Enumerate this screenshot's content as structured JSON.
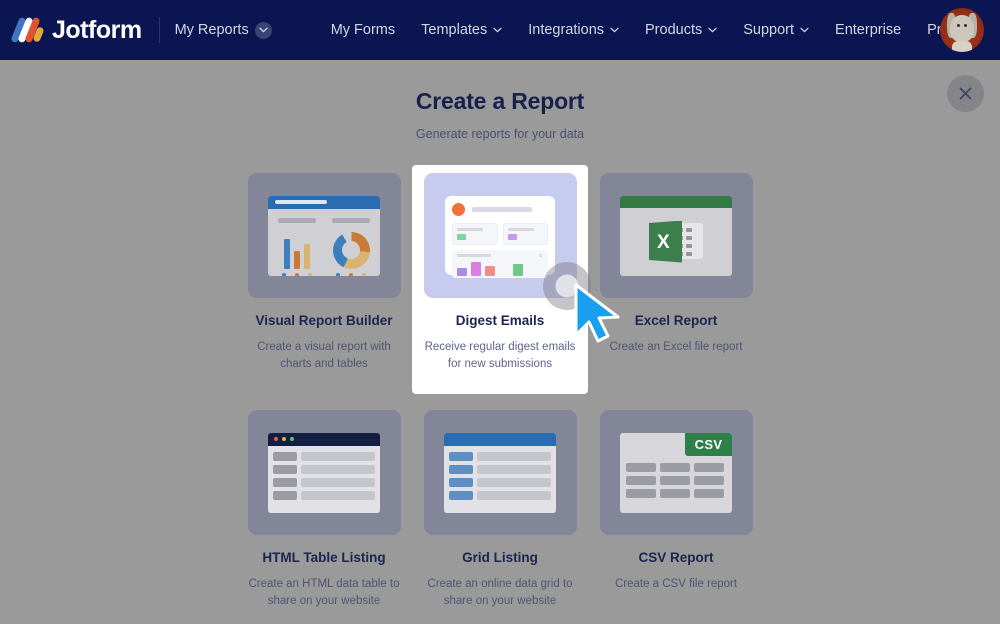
{
  "header": {
    "brand": "Jotform",
    "workspace": {
      "label": "My Reports",
      "chevron_icon": "chevron-down-icon"
    },
    "nav": [
      {
        "label": "My Forms",
        "has_chevron": false
      },
      {
        "label": "Templates",
        "has_chevron": true
      },
      {
        "label": "Integrations",
        "has_chevron": true
      },
      {
        "label": "Products",
        "has_chevron": true
      },
      {
        "label": "Support",
        "has_chevron": true
      },
      {
        "label": "Enterprise",
        "has_chevron": false
      },
      {
        "label": "Pricing",
        "has_chevron": false
      }
    ],
    "avatar_alt": "user-avatar",
    "bg_color": "#0a1551"
  },
  "modal": {
    "title": "Create a Report",
    "subtitle": "Generate reports for your data",
    "close_icon": "close-icon",
    "overlay_color": "#9a9a9a"
  },
  "cards": [
    {
      "id": "visual-report-builder",
      "title": "Visual Report Builder",
      "description": "Create a visual report with charts and tables",
      "selected": false,
      "icon": "visual-report-icon"
    },
    {
      "id": "digest-emails",
      "title": "Digest Emails",
      "description": "Receive regular digest emails for new submissions",
      "selected": true,
      "icon": "digest-email-icon"
    },
    {
      "id": "excel-report",
      "title": "Excel Report",
      "description": "Create an Excel file report",
      "selected": false,
      "icon": "excel-icon"
    },
    {
      "id": "html-table-listing",
      "title": "HTML Table Listing",
      "description": "Create an HTML data table to share on your website",
      "selected": false,
      "icon": "html-table-icon"
    },
    {
      "id": "grid-listing",
      "title": "Grid Listing",
      "description": "Create an online data grid to share on your website",
      "selected": false,
      "icon": "grid-listing-icon"
    },
    {
      "id": "csv-report",
      "title": "CSV Report",
      "description": "Create a CSV file report",
      "selected": false,
      "icon": "csv-icon",
      "badge_text": "CSV"
    }
  ],
  "excel_icon_letter": "X",
  "cursor": {
    "type": "pointer-arrow",
    "color": "#1a9ff0",
    "click_ripple": true
  }
}
